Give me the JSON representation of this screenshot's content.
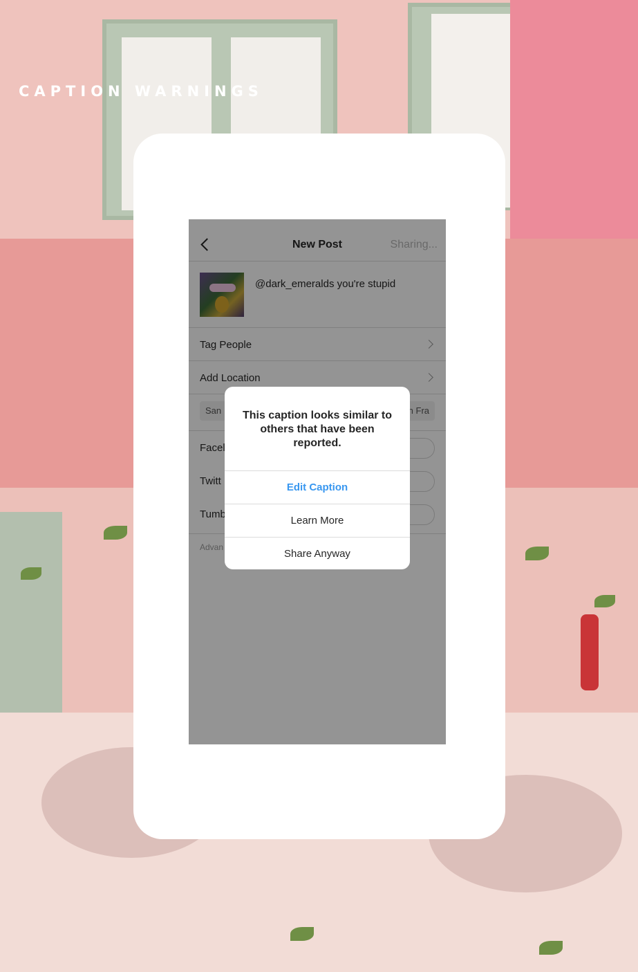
{
  "page": {
    "title": "CAPTION WARNINGS"
  },
  "nav": {
    "back_icon": "chevron-left-icon",
    "title": "New Post",
    "status": "Sharing..."
  },
  "post": {
    "caption": "@dark_emeralds you're stupid"
  },
  "options": {
    "tag_people": "Tag People",
    "add_location": "Add Location",
    "location_chip_left": "San",
    "location_chip_right": "n Fra",
    "share_facebook": "Facel",
    "share_twitter": "Twitt",
    "share_tumblr": "Tumb",
    "advanced": "Advan"
  },
  "dialog": {
    "message": "This caption looks similar to others that have been reported.",
    "edit_caption": "Edit Caption",
    "learn_more": "Learn More",
    "share_anyway": "Share Anyway"
  },
  "colors": {
    "accent_blue": "#3897f0",
    "card_white": "#ffffff",
    "overlay": "rgba(0,0,0,0.42)"
  }
}
